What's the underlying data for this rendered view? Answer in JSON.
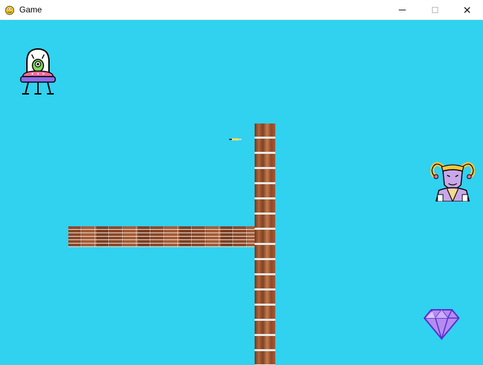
{
  "window": {
    "title": "Game",
    "icon": "pygame-snake-icon",
    "controls": [
      "minimize-icon",
      "maximize-icon",
      "close-icon"
    ],
    "close_glyph": "✕"
  },
  "game": {
    "background_color": "#31d1f0",
    "entities": [
      {
        "name": "alien-ufo-player",
        "icon": "alien-ufo-icon"
      },
      {
        "name": "jester-enemy",
        "icon": "jester-icon"
      },
      {
        "name": "diamond-gem",
        "icon": "diamond-icon"
      },
      {
        "name": "bullet-projectile",
        "icon": "bullet-icon"
      },
      {
        "name": "brick-wall-vertical",
        "icon": "brick-wall"
      },
      {
        "name": "brick-wall-horizontal",
        "icon": "brick-wall"
      }
    ]
  }
}
